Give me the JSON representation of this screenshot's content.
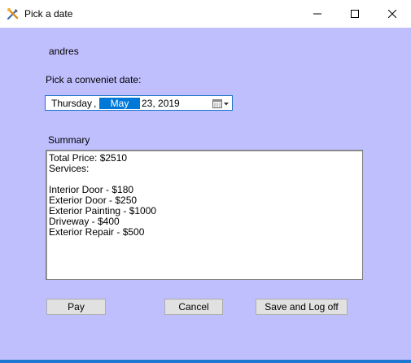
{
  "window": {
    "title": "Pick a date",
    "icon": "tools-icon",
    "controls": [
      "minimize-icon",
      "maximize-icon",
      "close-icon"
    ]
  },
  "form": {
    "username": "andres",
    "date_prompt": "Pick a conveniet date:",
    "date_picker": {
      "weekday": "Thursday",
      "separator": ",",
      "month": "May",
      "day_year": "23, 2019",
      "button_icon": "calendar-dropdown-icon"
    },
    "summary_label": "Summary",
    "summary_lines": [
      "Total Price: $2510",
      "Services:",
      "",
      "Interior Door - $180",
      "Exterior Door - $250",
      "Exterior Painting - $1000",
      "Driveway - $400",
      "Exterior Repair - $500"
    ],
    "buttons": {
      "pay": "Pay",
      "cancel": "Cancel",
      "save_logoff": "Save and Log off"
    }
  },
  "colors": {
    "client_background": "#bfbffe",
    "accent": "#0078d7"
  }
}
